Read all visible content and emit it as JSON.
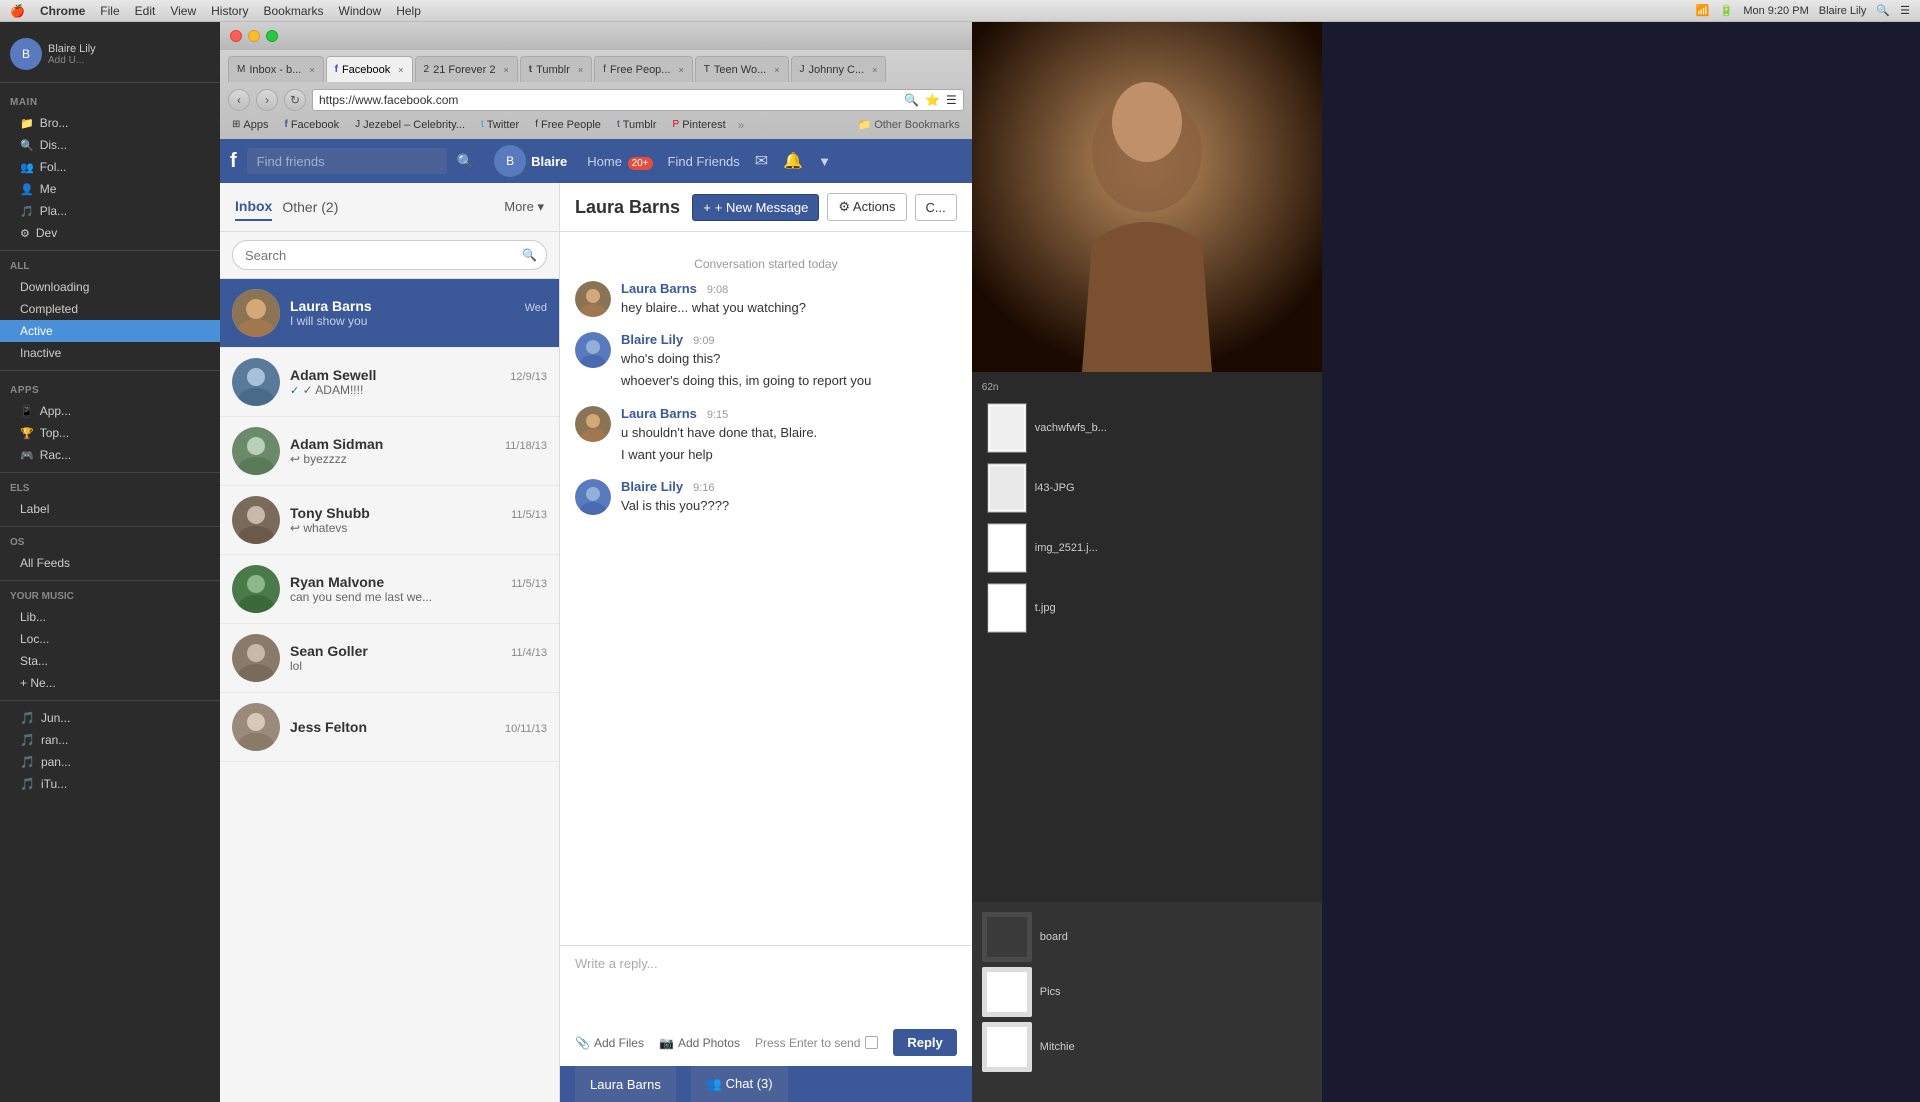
{
  "menubar": {
    "apple": "🍎",
    "items": [
      "Chrome",
      "File",
      "Edit",
      "View",
      "History",
      "Bookmarks",
      "Window",
      "Help"
    ],
    "right": {
      "time": "Mon 9:20 PM",
      "user": "Blaire Lily"
    }
  },
  "browser": {
    "tabs": [
      {
        "label": "Inbox - b...",
        "favicon": "M",
        "active": false
      },
      {
        "label": "Facebook",
        "favicon": "f",
        "active": true
      },
      {
        "label": "21 Forever 2",
        "favicon": "2",
        "active": false
      },
      {
        "label": "Tumblr",
        "favicon": "t",
        "active": false
      },
      {
        "label": "Free Peop...",
        "favicon": "f",
        "active": false
      },
      {
        "label": "Teen Wo...",
        "favicon": "T",
        "active": false
      },
      {
        "label": "Johnny C...",
        "favicon": "J",
        "active": false
      }
    ],
    "address": "https://www.facebook.com",
    "bookmarks": [
      {
        "label": "Apps",
        "icon": "⊞"
      },
      {
        "label": "Facebook",
        "icon": "f"
      },
      {
        "label": "Jezebel – Celebrity...",
        "icon": "J"
      },
      {
        "label": "Twitter",
        "icon": "t"
      },
      {
        "label": "Free People",
        "icon": "f"
      },
      {
        "label": "Tumblr",
        "icon": "t"
      },
      {
        "label": "Pinterest",
        "icon": "P"
      },
      {
        "label": "Other Bookmarks",
        "icon": "▶"
      }
    ]
  },
  "facebook": {
    "topnav": {
      "search_placeholder": "Find friends",
      "user": "Blaire",
      "nav_links": [
        "Home",
        "Find Friends"
      ],
      "home_badge": "20+"
    },
    "inbox": {
      "title": "Inbox",
      "other_tab": "Other (2)",
      "more_label": "More",
      "search_placeholder": "Search",
      "selected_conversation": "Laura Barns",
      "messages": [
        {
          "name": "Laura Barns",
          "date": "Wed",
          "preview": "I will show you",
          "selected": true
        },
        {
          "name": "Adam Sewell",
          "date": "12/9/13",
          "preview": "✓ ADAM!!!!",
          "selected": false
        },
        {
          "name": "Adam Sidman",
          "date": "11/18/13",
          "preview": "↩ byezzzz",
          "selected": false
        },
        {
          "name": "Tony Shubb",
          "date": "11/5/13",
          "preview": "↩ whatevs",
          "selected": false
        },
        {
          "name": "Ryan Malvone",
          "date": "11/5/13",
          "preview": "can you send me last we...",
          "selected": false
        },
        {
          "name": "Sean Goller",
          "date": "11/4/13",
          "preview": "lol",
          "selected": false
        },
        {
          "name": "Jess Felton",
          "date": "10/11/13",
          "preview": "",
          "selected": false
        }
      ]
    },
    "conversation": {
      "title": "Laura Barns",
      "new_message_label": "+ New Message",
      "actions_label": "⚙ Actions",
      "date_divider": "Conversation started today",
      "messages": [
        {
          "sender": "Laura Barns",
          "time": "9:08",
          "text": "hey blaire... what you watching?",
          "is_self": false
        },
        {
          "sender": "Blaire Lily",
          "time": "9:09",
          "text": "who's doing this?",
          "text2": "whoever's doing this, im going to report you",
          "is_self": true
        },
        {
          "sender": "Laura Barns",
          "time": "9:15",
          "text": "u shouldn't have done that, Blaire.",
          "text2": "I want your help",
          "is_self": false
        },
        {
          "sender": "Blaire Lily",
          "time": "9:16",
          "text": "Val is this you????",
          "is_self": true
        }
      ],
      "reply_placeholder": "Write a reply...",
      "add_files_label": "Add Files",
      "add_photos_label": "Add Photos",
      "press_enter_label": "Press Enter to send",
      "reply_label": "Reply"
    },
    "bottom_bar": {
      "chat_label": "Laura Barns",
      "chat_count_label": "👥 Chat (3)"
    }
  },
  "left_sidebar": {
    "main_section": "MAIN",
    "main_items": [
      "Browse",
      "Discover",
      "Following",
      "Me",
      "Playlists",
      "Dev"
    ],
    "apps_section": "APPS",
    "apps_items": [
      "App...",
      "Top...",
      "Rac..."
    ],
    "filters": {
      "all": "All",
      "downloading": "Downloading",
      "completed": "Completed",
      "active": "Active",
      "inactive": "Inactive"
    },
    "labels_section": "LABELS",
    "label_item": "Label",
    "os_section": "OS",
    "os_item": "All Feeds",
    "your_music": "YOUR MUSIC",
    "music_items": [
      "Lib...",
      "Loc...",
      "Sta..."
    ],
    "new_item": "+ Ne...",
    "music_files": [
      "Jun...",
      "ran...",
      "pan...",
      "iTu..."
    ]
  },
  "right_area": {
    "files": [
      {
        "name": "vachwfwfs_b...",
        "ext": ".jpg"
      },
      {
        "name": "l43-JPG",
        "ext": ".jpg"
      },
      {
        "name": "img_2521.j...",
        "ext": ".jpg"
      },
      {
        "name": "t.jpg",
        "ext": ".jpg"
      }
    ],
    "bottom_items": [
      {
        "label": "board"
      },
      {
        "label": "Pics"
      },
      {
        "label": "Mitchie"
      }
    ]
  },
  "colors": {
    "fb_blue": "#3b5998",
    "fb_light_blue": "#4a6298",
    "selected_msg_bg": "#3b5998",
    "accent": "#3b5998"
  }
}
